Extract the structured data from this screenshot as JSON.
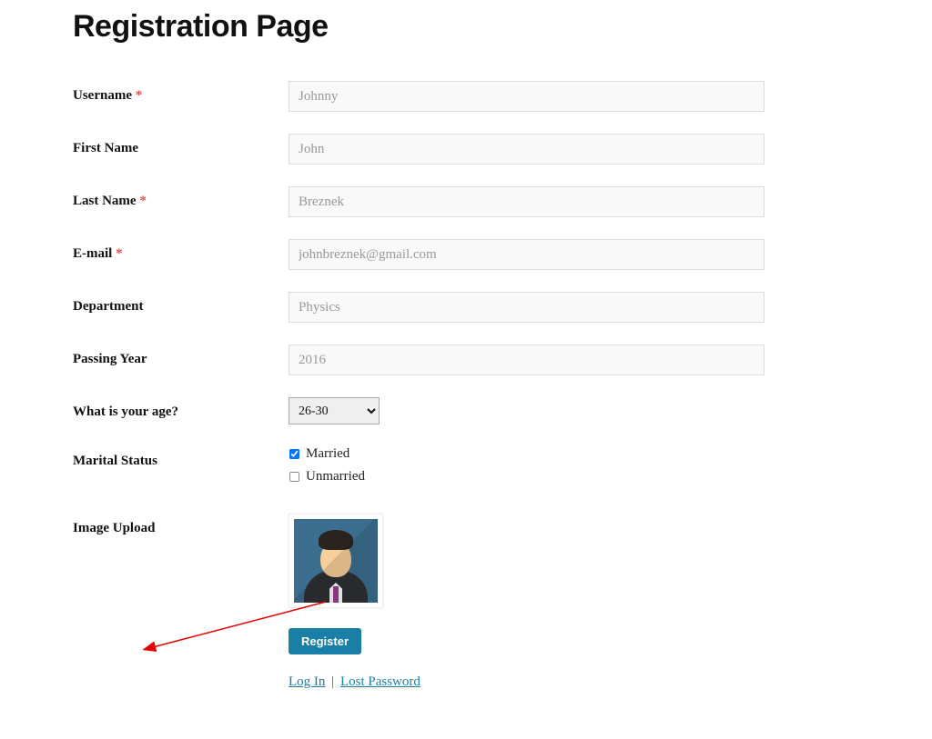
{
  "page": {
    "title": "Registration Page"
  },
  "fields": {
    "username": {
      "label": "Username",
      "required": true,
      "placeholder": "Johnny"
    },
    "firstname": {
      "label": "First Name",
      "required": false,
      "placeholder": "John"
    },
    "lastname": {
      "label": "Last Name",
      "required": true,
      "placeholder": "Breznek"
    },
    "email": {
      "label": "E-mail",
      "required": true,
      "placeholder": "johnbreznek@gmail.com"
    },
    "department": {
      "label": "Department",
      "required": false,
      "placeholder": "Physics"
    },
    "passingyear": {
      "label": "Passing Year",
      "required": false,
      "placeholder": "2016"
    },
    "age": {
      "label": "What is your age?",
      "selected": "26-30"
    },
    "marital": {
      "label": "Marital Status",
      "options": [
        {
          "label": "Married",
          "checked": true
        },
        {
          "label": "Unmarried",
          "checked": false
        }
      ]
    },
    "image": {
      "label": "Image Upload"
    }
  },
  "actions": {
    "register": "Register",
    "login": "Log In",
    "lost_password": "Lost Password",
    "sep": "|"
  },
  "required_marker": "*"
}
